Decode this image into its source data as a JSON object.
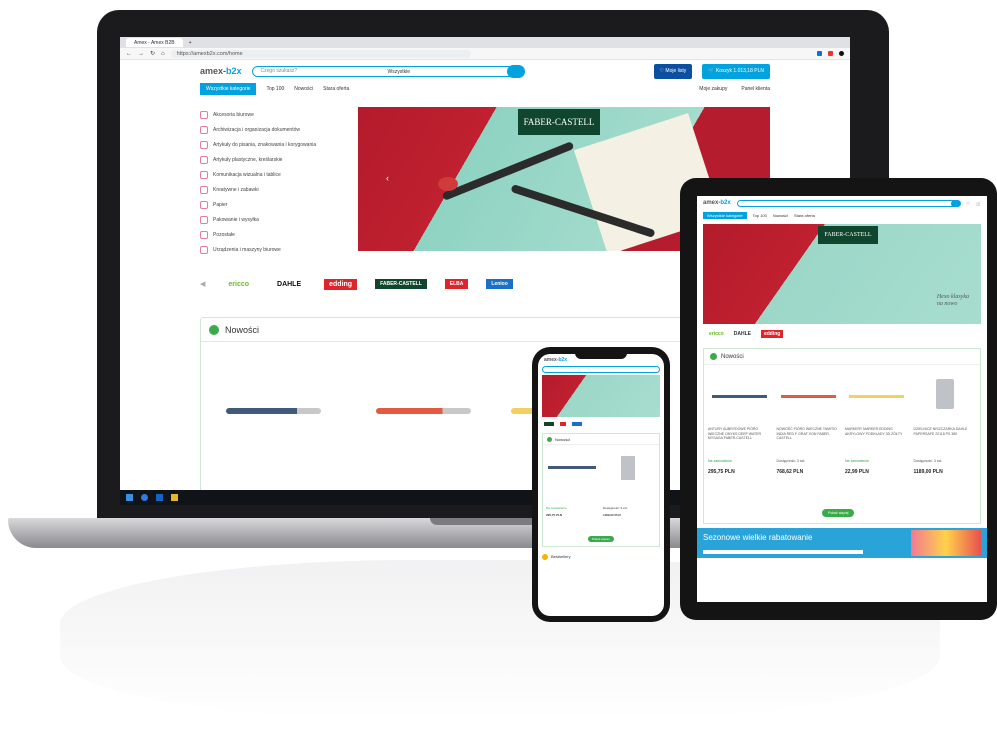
{
  "browser": {
    "tab_title": "Amex - Amex B2B",
    "url": "https://amexb2x.com/home"
  },
  "site": {
    "logo_prefix": "amex-",
    "logo_suffix": "b2x",
    "search_placeholder": "Czego szukasz?",
    "search_category": "Wszystkie",
    "wishlist_label": "Moje listy",
    "cart_label": "Koszyk",
    "cart_sub": "1.013,18 PLN",
    "nav_tabs": [
      "Wszystkie kategorie",
      "Top 100",
      "Nowości",
      "Stara oferta"
    ],
    "nav_right": [
      "Moje zakupy",
      "Panel klienta"
    ],
    "categories": [
      "Akcesoria biurowe",
      "Archiwizacja i organizacja dokumentów",
      "Artykuły do pisania, znakowania i korygowania",
      "Artykuły plastyczne, kreślarskie",
      "Komunikacja wizualna i tablice",
      "Kreatywne i zabawki",
      "Papier",
      "Pakowanie i wysyłka",
      "Pozostałe",
      "Urządzenia i maszyny biurowe"
    ],
    "hero_brand": "FABER-CASTELL",
    "hero_slogan_line1": "Hexo klasyka",
    "hero_slogan_line2": "na nowo",
    "brands": [
      "ericco",
      "DAHLE",
      "edding",
      "FABER-CASTELL",
      "ELBA",
      "Lenioo"
    ],
    "news_title": "Nowości"
  },
  "tablet": {
    "products": [
      {
        "desc": "ANTURY\nAUBRYDOWE PIÓRO WIECZNE ONYKS DEEP WATER MYSAGA FABER-CASTELL",
        "avail": "Na zamówienie",
        "price": "295,75 PLN"
      },
      {
        "desc": "NOWOŚĆ\nPIÓRO WIECZNE TAMITIO INDIA RED F GRAF VON FABER-CASTELL",
        "avail": "Dostępność: 3 szt.",
        "price": "768,62 PLN"
      },
      {
        "desc": "MARKERY\nMARKER EDDING AKRYLOWY PODKŁADY 3D ŻÓŁTY",
        "avail": "Na zamówienie",
        "price": "22,99 PLN"
      },
      {
        "desc": "DZIELNICE\nNISZCZARKA DAHLE PAPERSAFE 22118 PS 380",
        "avail": "Dostępność: 3 szt.",
        "price": "1189,00 PLN"
      }
    ],
    "more_label": "Pokaż więcej",
    "banner_text": "Sezonowe wielkie rabatowanie",
    "bestsellers": "Bestsellery"
  },
  "colors": {
    "accent": "#00a3e0",
    "navy": "#0a4fa0",
    "green": "#3aaa4a",
    "brand_green": "#10452e",
    "hero_red": "#b31b2c",
    "hero_mint": "#9cd7c8"
  }
}
